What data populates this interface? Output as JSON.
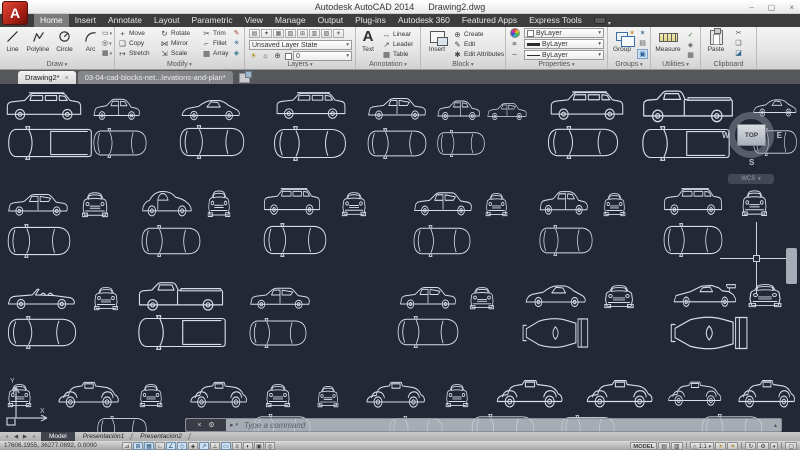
{
  "window": {
    "logo_letter": "A",
    "product": "Autodesk AutoCAD 2014",
    "document": "Drawing2.dwg"
  },
  "ribbon": {
    "tabs": [
      {
        "label": "Home",
        "active": true
      },
      {
        "label": "Insert",
        "active": false
      },
      {
        "label": "Annotate",
        "active": false
      },
      {
        "label": "Layout",
        "active": false
      },
      {
        "label": "Parametric",
        "active": false
      },
      {
        "label": "View",
        "active": false
      },
      {
        "label": "Manage",
        "active": false
      },
      {
        "label": "Output",
        "active": false
      },
      {
        "label": "Plug-ins",
        "active": false
      },
      {
        "label": "Autodesk 360",
        "active": false
      },
      {
        "label": "Featured Apps",
        "active": false
      },
      {
        "label": "Express Tools",
        "active": false
      }
    ],
    "panels": {
      "draw": {
        "label": "Draw",
        "tools": [
          "Line",
          "Polyline",
          "Circle",
          "Arc"
        ]
      },
      "modify": {
        "label": "Modify",
        "tools": [
          "Move",
          "Copy",
          "Stretch",
          "Rotate",
          "Mirror",
          "Scale",
          "Trim",
          "Fillet",
          "Array"
        ]
      },
      "layers": {
        "label": "Layers",
        "state": "Unsaved Layer State",
        "current": "0",
        "icons": [
          "▤",
          "✦",
          "▦",
          "▧",
          "⊞",
          "▥",
          "▨",
          "☀"
        ]
      },
      "annotation": {
        "label": "Annotation",
        "tools": [
          "Text",
          "Linear",
          "Leader",
          "Table"
        ]
      },
      "block": {
        "label": "Block",
        "tools": [
          "Insert",
          "Create",
          "Edit",
          "Edit Attributes"
        ]
      },
      "properties": {
        "label": "Properties",
        "color": "ByLayer",
        "lineweight": "ByLayer",
        "linetype": "ByLayer"
      },
      "groups": {
        "label": "Groups",
        "tool": "Group"
      },
      "utilities": {
        "label": "Utilities",
        "tool": "Measure"
      },
      "clipboard": {
        "label": "Clipboard",
        "tool": "Paste"
      }
    }
  },
  "file_tabs": [
    {
      "label": "Drawing2*",
      "active": true
    },
    {
      "label": "03-04-cad-blocks-net...levations-and-plan*",
      "active": false
    }
  ],
  "canvas": {
    "viewcube": {
      "top": "TOP",
      "west": "W",
      "east": "E",
      "south": "S"
    },
    "wcs": "WCS",
    "ucs": {
      "x": "X",
      "y": "Y"
    },
    "cars": [
      [
        "suv",
        4,
        6,
        80,
        32
      ],
      [
        "hatch",
        92,
        12,
        50,
        26
      ],
      [
        "sports",
        180,
        12,
        62,
        26
      ],
      [
        "suv",
        274,
        6,
        74,
        31
      ],
      [
        "sedan",
        366,
        10,
        62,
        28
      ],
      [
        "hatch",
        436,
        14,
        46,
        24
      ],
      [
        "sedan",
        486,
        16,
        42,
        22
      ],
      [
        "suv",
        548,
        5,
        78,
        33
      ],
      [
        "pickup",
        640,
        3,
        96,
        38
      ],
      [
        "sports",
        752,
        12,
        46,
        22
      ],
      [
        "pickup-top",
        6,
        42,
        88,
        34
      ],
      [
        "car-top",
        92,
        44,
        56,
        30
      ],
      [
        "car-top",
        178,
        41,
        68,
        34
      ],
      [
        "car-top",
        272,
        42,
        76,
        35
      ],
      [
        "car-top",
        366,
        44,
        62,
        31
      ],
      [
        "car-top",
        436,
        46,
        50,
        27
      ],
      [
        "car-top",
        546,
        42,
        74,
        33
      ],
      [
        "pickup-top",
        640,
        42,
        92,
        35
      ],
      [
        "car-top",
        752,
        44,
        46,
        28
      ],
      [
        "sedan",
        6,
        106,
        64,
        28
      ],
      [
        "front",
        80,
        106,
        30,
        28
      ],
      [
        "beetle",
        140,
        104,
        54,
        30
      ],
      [
        "front",
        206,
        104,
        26,
        30
      ],
      [
        "suv",
        262,
        102,
        60,
        31
      ],
      [
        "front",
        340,
        106,
        28,
        27
      ],
      [
        "sedan",
        412,
        104,
        62,
        30
      ],
      [
        "front",
        484,
        107,
        25,
        26
      ],
      [
        "hatch",
        538,
        104,
        52,
        29
      ],
      [
        "front",
        602,
        107,
        25,
        26
      ],
      [
        "suv",
        662,
        102,
        62,
        31
      ],
      [
        "front",
        740,
        104,
        29,
        29
      ],
      [
        "car-top",
        6,
        140,
        66,
        34
      ],
      [
        "car-top",
        140,
        141,
        62,
        32
      ],
      [
        "car-top",
        262,
        139,
        66,
        34
      ],
      [
        "car-top",
        412,
        141,
        60,
        32
      ],
      [
        "car-top",
        538,
        141,
        56,
        31
      ],
      [
        "car-top",
        662,
        139,
        62,
        34
      ],
      [
        "convertible",
        6,
        199,
        72,
        28
      ],
      [
        "front",
        92,
        201,
        28,
        26
      ],
      [
        "pickup",
        136,
        195,
        90,
        34
      ],
      [
        "sedan",
        248,
        200,
        64,
        27
      ],
      [
        "sedan",
        398,
        199,
        60,
        28
      ],
      [
        "front",
        468,
        201,
        28,
        25
      ],
      [
        "sports",
        524,
        197,
        64,
        28
      ],
      [
        "front",
        602,
        199,
        34,
        26
      ],
      [
        "race",
        672,
        196,
        66,
        28
      ],
      [
        "front",
        746,
        198,
        38,
        26
      ],
      [
        "car-top",
        6,
        232,
        72,
        33
      ],
      [
        "pickup-top",
        136,
        231,
        92,
        35
      ],
      [
        "car-top",
        248,
        234,
        60,
        30
      ],
      [
        "car-top",
        396,
        232,
        64,
        32
      ],
      [
        "race-top",
        522,
        230,
        70,
        38
      ],
      [
        "race-top",
        670,
        228,
        82,
        42
      ],
      [
        "front",
        6,
        298,
        27,
        26
      ],
      [
        "classic",
        56,
        294,
        66,
        32
      ],
      [
        "front",
        138,
        298,
        26,
        26
      ],
      [
        "classic",
        188,
        294,
        62,
        32
      ],
      [
        "front",
        264,
        298,
        28,
        26
      ],
      [
        "front",
        316,
        300,
        24,
        24
      ],
      [
        "classic",
        364,
        294,
        64,
        32
      ],
      [
        "front",
        444,
        298,
        26,
        26
      ],
      [
        "classic",
        494,
        292,
        72,
        34
      ],
      [
        "classic",
        584,
        292,
        72,
        34
      ],
      [
        "classic",
        666,
        294,
        58,
        30
      ],
      [
        "classic",
        736,
        292,
        62,
        34
      ],
      [
        "car-top",
        96,
        332,
        52,
        26
      ],
      [
        "car-top",
        252,
        330,
        60,
        28
      ],
      [
        "car-top",
        388,
        332,
        56,
        26
      ],
      [
        "car-top",
        470,
        330,
        66,
        28
      ],
      [
        "car-top",
        560,
        331,
        56,
        26
      ],
      [
        "car-top",
        700,
        330,
        64,
        28
      ]
    ]
  },
  "command_bar": {
    "placeholder": "Type a command"
  },
  "layout_tabs": [
    {
      "label": "Model",
      "active": true
    },
    {
      "label": "Presentación1",
      "active": false
    },
    {
      "label": "Presentación2",
      "active": false
    }
  ],
  "status_bar": {
    "coordinates": "17606.1955, 36277.0892, 0.0000",
    "toggles": [
      {
        "name": "infer-constraints",
        "glyph": "⊿",
        "active": false
      },
      {
        "name": "snap-mode",
        "glyph": "⊞",
        "active": true
      },
      {
        "name": "grid-display",
        "glyph": "▦",
        "active": true
      },
      {
        "name": "ortho-mode",
        "glyph": "∟",
        "active": false
      },
      {
        "name": "polar-tracking",
        "glyph": "∠",
        "active": true
      },
      {
        "name": "object-snap",
        "glyph": "◇",
        "active": true
      },
      {
        "name": "3d-object-snap",
        "glyph": "◈",
        "active": false
      },
      {
        "name": "object-snap-tracking",
        "glyph": "↗",
        "active": true
      },
      {
        "name": "dynamic-ucs",
        "glyph": "⊥",
        "active": false
      },
      {
        "name": "dynamic-input",
        "glyph": "▭",
        "active": true
      },
      {
        "name": "lineweight",
        "glyph": "≡",
        "active": false
      },
      {
        "name": "transparency",
        "glyph": "◐",
        "active": false
      },
      {
        "name": "quick-properties",
        "glyph": "▣",
        "active": false
      },
      {
        "name": "selection-cycling",
        "glyph": "◎",
        "active": false
      }
    ],
    "model_label": "MODEL",
    "annotation_scale": "1:1"
  }
}
